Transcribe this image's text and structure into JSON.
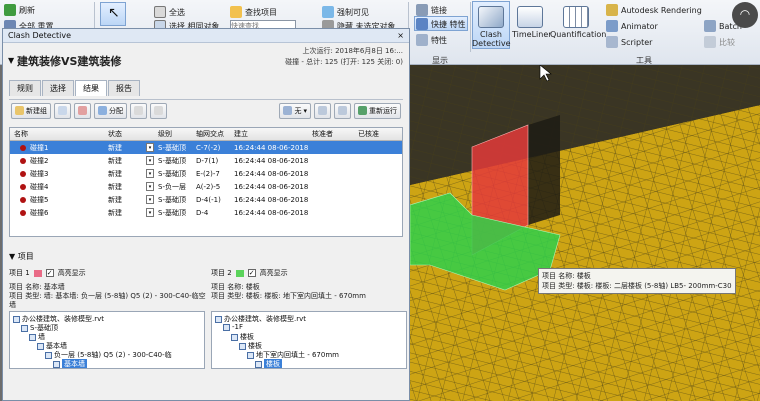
{
  "ribbon": {
    "left_items": [
      {
        "label": "刷新",
        "icon": "refresh-icon"
      },
      {
        "label": "全部 重置...",
        "icon": "reset-icon"
      },
      {
        "label": "全选",
        "icon": "select-all-icon"
      },
      {
        "label": "选择 相同对象",
        "icon": "select-same-icon"
      },
      {
        "label": "查找项目",
        "icon": "find-items-icon"
      },
      {
        "label": "强制可见",
        "icon": "require-icon"
      },
      {
        "label": "隐藏 未选定对象",
        "icon": "hide-unselected-icon"
      }
    ],
    "quick_find_placeholder": "快速查找",
    "mid_items": [
      {
        "label": "链接",
        "icon": "link-icon"
      },
      {
        "label": "快捷 特性",
        "icon": "quick-properties-icon"
      },
      {
        "label": "特性",
        "icon": "properties-icon"
      }
    ],
    "display_section": "显示",
    "big_tools": [
      {
        "label": "Clash Detective",
        "icon": "clash-detective-icon"
      },
      {
        "label": "TimeLiner",
        "icon": "timeliner-icon"
      },
      {
        "label": "Quantification",
        "icon": "quantification-icon"
      }
    ],
    "right_items": [
      {
        "label": "Autodesk Rendering",
        "icon": "rendering-icon"
      },
      {
        "label": "Animator",
        "icon": "animator-icon"
      },
      {
        "label": "Scripter",
        "icon": "scripter-icon"
      },
      {
        "label": "Batch",
        "icon": "batch-icon"
      },
      {
        "label": "比较",
        "icon": "compare-icon"
      }
    ],
    "tools_section": "工具"
  },
  "dialog": {
    "window_title": "Clash Detective",
    "test_name": "建筑装修VS建筑装修",
    "last_run_label": "上次运行:  2018年6月8日 16:...",
    "summary": "碰撞 - 总计: 125  (打开: 125  关闭: 0)",
    "tabs": [
      "规则",
      "选择",
      "结果",
      "报告"
    ],
    "active_tab": 2,
    "toolbar": {
      "new_group": "新建组",
      "assign": "分配",
      "none_dropdown": "无",
      "rerun": "重新运行"
    },
    "columns": [
      "名称",
      "状态",
      "级别",
      "轴网交点",
      "建立",
      "核准者",
      "已核准"
    ],
    "rows": [
      {
        "name": "碰撞1",
        "status": "新建",
        "level": "S-基础顶",
        "grid": "C-7(-2)",
        "created": "16:24:44 08-06-2018"
      },
      {
        "name": "碰撞2",
        "status": "新建",
        "level": "S-基础顶",
        "grid": "D-7(1)",
        "created": "16:24:44 08-06-2018"
      },
      {
        "name": "碰撞3",
        "status": "新建",
        "level": "S-基础顶",
        "grid": "E-(2)-7",
        "created": "16:24:44 08-06-2018"
      },
      {
        "name": "碰撞4",
        "status": "新建",
        "level": "S-负一层",
        "grid": "A(-2)-5",
        "created": "16:24:44 08-06-2018"
      },
      {
        "name": "碰撞5",
        "status": "新建",
        "level": "S-基础顶",
        "grid": "D-4(-1)",
        "created": "16:24:44 08-06-2018"
      },
      {
        "name": "碰撞6",
        "status": "新建",
        "level": "S-基础顶",
        "grid": "D-4",
        "created": "16:24:44 08-06-2018"
      }
    ],
    "selected_row": 0,
    "items_section": "项目",
    "item1": {
      "label": "项目 1",
      "swatch": "#e96b86",
      "highlight": "高亮显示",
      "desc1": "项目 名称: 基本墙",
      "desc2": "项目 类型: 墙: 基本墙: 负一层 (5-8轴) Q5 (2) - 300-C40-临空墙",
      "tree": [
        "办公楼建筑、装修模型.rvt",
        "S-基础顶",
        "墙",
        "基本墙",
        "负一层 (5-8轴) Q5 (2) - 300-C40-临",
        "基本墙"
      ]
    },
    "item2": {
      "label": "项目 2",
      "swatch": "#5bd35b",
      "highlight": "高亮显示",
      "desc1": "项目 名称: 楼板",
      "desc2": "项目 类型: 楼板: 楼板: 地下室内回填土 - 670mm",
      "tree": [
        "办公楼建筑、装修模型.rvt",
        "-1F",
        "楼板",
        "楼板",
        "地下室内回填土 - 670mm",
        "楼板"
      ]
    }
  },
  "tooltip": {
    "line1": "项目 名称: 楼板",
    "line2": "项目 类型: 楼板: 楼板: 二层楼板 (5-8轴) LB5- 200mm-C30"
  },
  "colors": {
    "clash_red": "#e33a3a",
    "clash_green": "#2fd04a",
    "model_yellow": "#d1a710",
    "selection_blue": "#3b80d8"
  }
}
